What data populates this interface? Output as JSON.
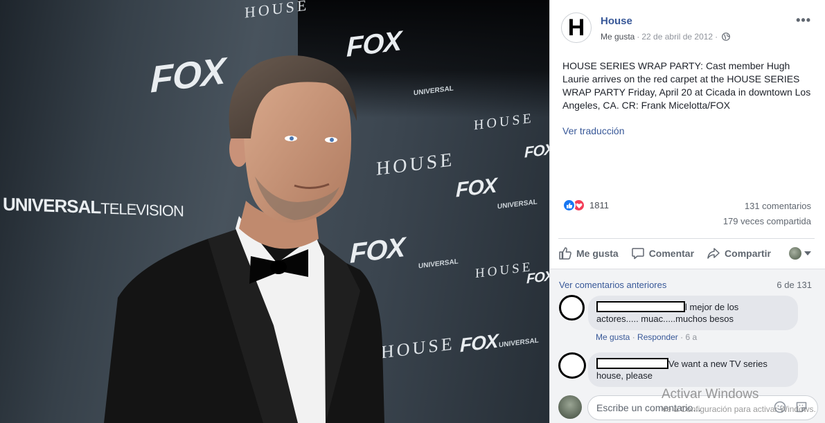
{
  "photo": {
    "backdrop_logos": {
      "fox": "FOX",
      "house": "HOUSE",
      "universal_main": "UNIVERSAL",
      "universal_sub": "TELEVISION",
      "universal_small": "UNIVERSAL"
    }
  },
  "post": {
    "page_initial": "H",
    "page_name": "House",
    "like_link": "Me gusta",
    "dot": "·",
    "date": "22 de abril de 2012",
    "more": "•••",
    "text": "HOUSE SERIES WRAP PARTY: Cast member Hugh Laurie arrives on the red carpet at the HOUSE SERIES WRAP PARTY Friday, April 20 at Cicada in downtown Los Angeles, CA. CR: Frank Micelotta/FOX",
    "translate": "Ver traducción",
    "reaction_count": "1811",
    "comments_count": "131 comentarios",
    "shares_count": "179 veces compartida"
  },
  "actions": {
    "like": "Me gusta",
    "comment": "Comentar",
    "share": "Compartir"
  },
  "comments": {
    "prev_link": "Ver comentarios anteriores",
    "count_of": "6 de 131",
    "items": [
      {
        "text_line1": "l mejor de los",
        "text_line2": "actores..... muac.....muchos besos",
        "like": "Me gusta",
        "reply": "Responder",
        "dot": "·",
        "age": "6 a"
      },
      {
        "text_line1": "Ve want a new TV series",
        "text_line2": "house, please"
      }
    ],
    "composer_placeholder": "Escribe un comentario..."
  },
  "watermark": {
    "title": "Activar Windows",
    "subtitle": "Ve a Configuración para activar Windows."
  }
}
